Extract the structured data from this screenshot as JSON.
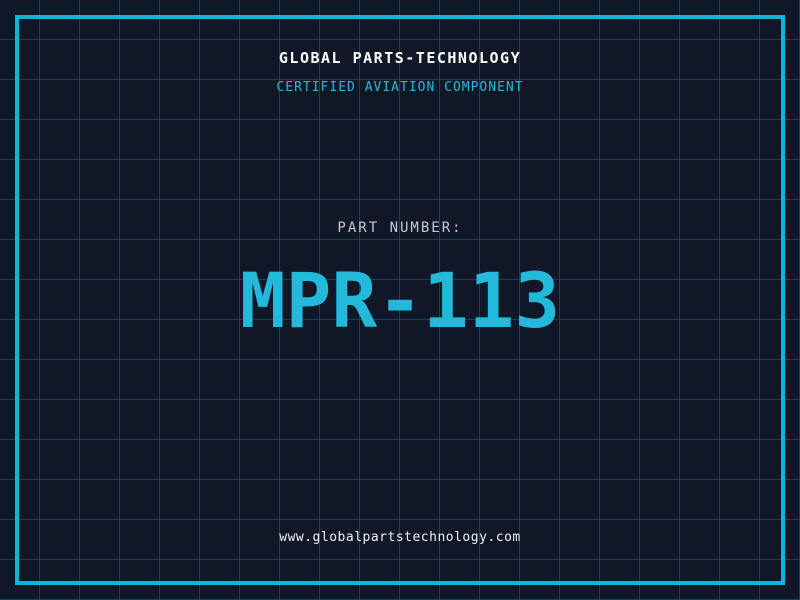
{
  "page": {
    "company_name": "GLOBAL PARTS-TECHNOLOGY",
    "subtitle": "CERTIFIED AVIATION COMPONENT",
    "part_label": "PART NUMBER:",
    "part_number": "MPR-113",
    "website": "www.globalpartstechnology.com"
  },
  "colors": {
    "background": "#101827",
    "grid_line": "#1b4a60",
    "frame": "#0db6d9",
    "accent_cyan": "#23b9db",
    "text_white": "#ffffff",
    "text_gray": "#c2cad3"
  }
}
